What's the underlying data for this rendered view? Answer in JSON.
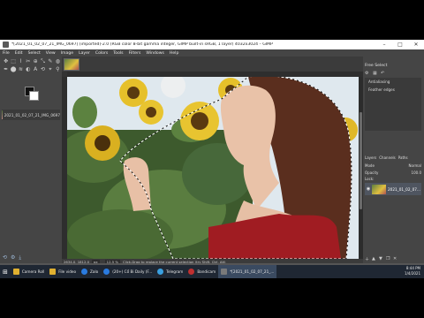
{
  "window": {
    "title": "*[2021_01_02_07_21_IMG_0697] (imported)-2.0 (RGB color 8-bit gamma integer, GIMP built-in sRGB, 1 layer) 4032x3024 – GIMP",
    "controls": {
      "minimize": "–",
      "maximize": "□",
      "close": "✕"
    }
  },
  "menu": [
    "File",
    "Edit",
    "Select",
    "View",
    "Image",
    "Layer",
    "Colors",
    "Tools",
    "Filters",
    "Windows",
    "Help"
  ],
  "toolbox": {
    "tools": [
      "✥",
      "⬚",
      "⌇",
      "✂",
      "⊕",
      "⤡",
      "✎",
      "◍",
      "✒",
      "⬤",
      "≋",
      "◐",
      "A",
      "⟲",
      "⌖",
      "⚲"
    ],
    "image_tab_label": "2021_01_02_07_21_IMG_0697",
    "bottom_icons": [
      "⟲",
      "⚙",
      "⤓"
    ]
  },
  "dock": {
    "title": "Free Select",
    "options": [
      "Antialiasing",
      "Feather edges"
    ],
    "tabs": [
      "Layers",
      "Channels",
      "Paths"
    ],
    "mode_label": "Mode",
    "mode_value": "Normal",
    "opacity_label": "Opacity",
    "opacity_value": "100.0",
    "lock_label": "Lock:",
    "layer_name": "2021_01_02_07..."
  },
  "statusbar": {
    "coords": "2634.0, 1812.0",
    "unit": "px",
    "zoom": "12.5 %",
    "hint": "Click-Drag to replace the current selection (try Shift, Ctrl, Alt)"
  },
  "taskbar": {
    "items": [
      {
        "label": "Camera Roll",
        "color": "#e0b030",
        "active": false
      },
      {
        "label": "File video",
        "color": "#e0b030",
        "active": false
      },
      {
        "label": "Zalo",
        "color": "#2a7be0",
        "active": false
      },
      {
        "label": "(20+) Cổ Bi Daily (F...",
        "color": "#2a7be0",
        "active": false
      },
      {
        "label": "Telegram",
        "color": "#3aa0e0",
        "active": false
      },
      {
        "label": "Bandicam",
        "color": "#c03030",
        "active": false
      },
      {
        "label": "*[2021_01_02_07_21_...",
        "color": "#7a7a7a",
        "active": true
      }
    ],
    "time": "8:44 PM",
    "date": "1/4/2021"
  },
  "video": {
    "progress": 0.0
  }
}
